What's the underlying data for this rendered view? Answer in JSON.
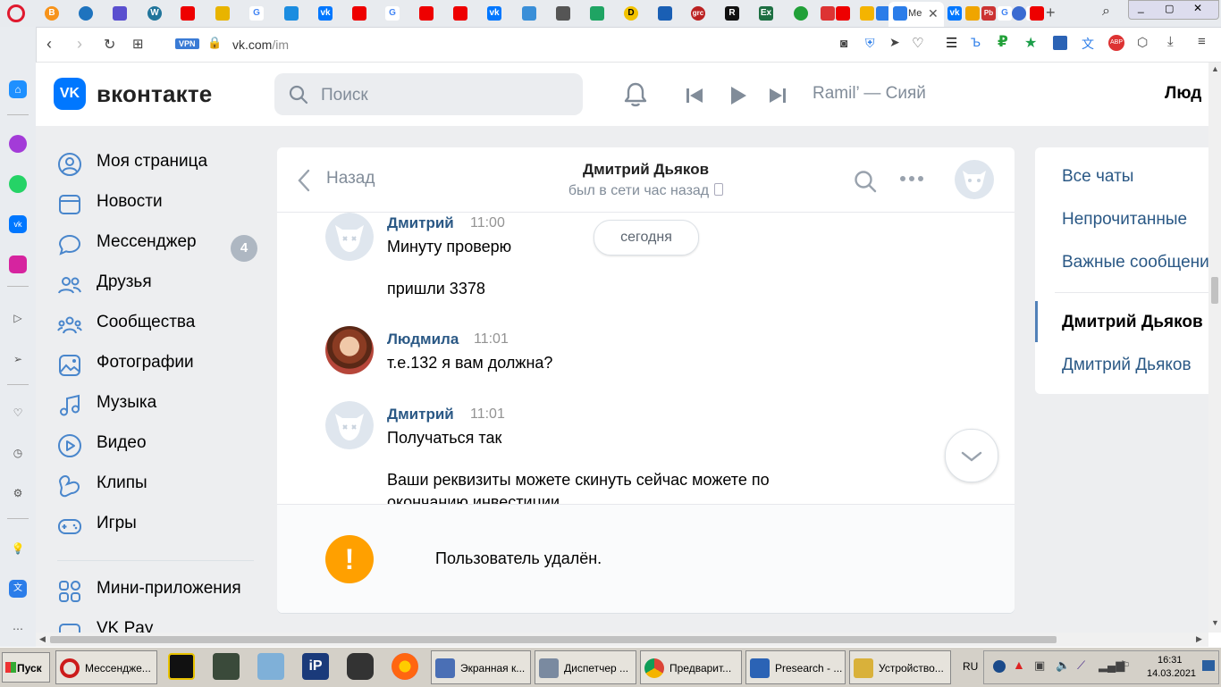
{
  "browser": {
    "active_tab_label": "Ме",
    "url_host": "vk.com",
    "url_path": "/im",
    "vpn_badge": "VPN"
  },
  "vk": {
    "logo_text": "вконтакте",
    "logo_mark": "VK",
    "search_placeholder": "Поиск",
    "now_playing": "Ramil’ — Сияй",
    "user_name_partial": "Люд"
  },
  "nav": {
    "items": [
      {
        "label": "Моя страница",
        "icon": "user-circle-icon"
      },
      {
        "label": "Новости",
        "icon": "newspaper-icon"
      },
      {
        "label": "Мессенджер",
        "icon": "chat-bubble-icon",
        "badge": "4"
      },
      {
        "label": "Друзья",
        "icon": "friends-icon"
      },
      {
        "label": "Сообщества",
        "icon": "communities-icon"
      },
      {
        "label": "Фотографии",
        "icon": "photo-icon"
      },
      {
        "label": "Музыка",
        "icon": "music-note-icon"
      },
      {
        "label": "Видео",
        "icon": "video-play-icon"
      },
      {
        "label": "Клипы",
        "icon": "clips-icon"
      },
      {
        "label": "Игры",
        "icon": "gamepad-icon"
      },
      {
        "label": "Мини-приложения",
        "icon": "mini-apps-icon"
      },
      {
        "label": "VK Pay",
        "icon": "vkpay-icon"
      }
    ]
  },
  "chat": {
    "back_label": "Назад",
    "peer_name": "Дмитрий Дьяков",
    "peer_status": "был в сети час назад",
    "date_divider": "сегодня",
    "messages": [
      {
        "author": "Дмитрий",
        "time": "11:00",
        "lines": [
          "Минуту проверю",
          "пришли 3378"
        ]
      },
      {
        "author": "Людмила",
        "time": "11:01",
        "lines": [
          "т.е.132 я вам должна?"
        ]
      },
      {
        "author": "Дмитрий",
        "time": "11:01",
        "lines": [
          "Получаться так",
          "Ваши реквизиты можете скинуть сейчас можете по",
          "окончанию инвестиции"
        ]
      }
    ],
    "deleted_notice": "Пользователь удалён.",
    "warn_glyph": "!"
  },
  "right_panel": {
    "all_chats": "Все чаты",
    "unread": "Непрочитанные",
    "important": "Важные сообщения",
    "active_chat": "Дмитрий Дьяков",
    "other_chat": "Дмитрий Дьяков"
  },
  "taskbar": {
    "start_label": "Пуск",
    "buttons": [
      {
        "label": "Мессендже...",
        "color": "#cc1b1b"
      },
      {
        "label": "Экранная к...",
        "color": "#4a6fb5"
      },
      {
        "label": "Диспетчер ...",
        "color": "#7a8aa0"
      },
      {
        "label": "Предварит...",
        "color": "#2f9e44"
      },
      {
        "label": "Presearch - ...",
        "color": "#2b63b5"
      },
      {
        "label": "Устройство...",
        "color": "#d9b13a"
      }
    ],
    "lang": "RU",
    "time": "16:31",
    "date": "14.03.2021"
  },
  "colors": {
    "vk_blue": "#0077ff",
    "link_blue": "#2a5885",
    "muted": "#818c99",
    "page_bg": "#edeef0",
    "warn_orange": "#ffa000"
  }
}
